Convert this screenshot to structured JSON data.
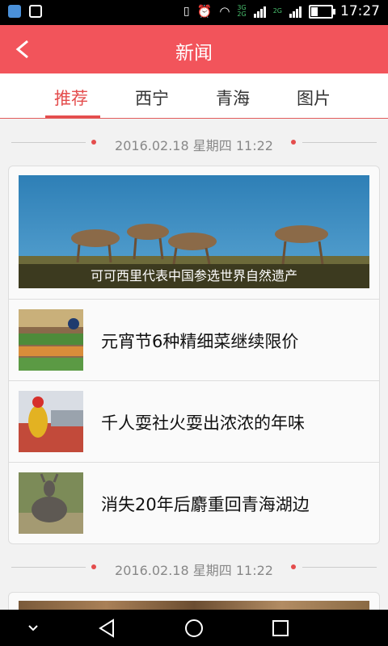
{
  "status_bar": {
    "time": "17:27",
    "net_a": "3G",
    "net_b": "2G",
    "net_c": "2G"
  },
  "header": {
    "title": "新闻",
    "back_label": "<"
  },
  "tabs": [
    {
      "label": "推荐",
      "active": true
    },
    {
      "label": "西宁",
      "active": false
    },
    {
      "label": "青海",
      "active": false
    },
    {
      "label": "图片",
      "active": false
    }
  ],
  "groups": [
    {
      "date": "2016.02.18 星期四 11:22",
      "hero_caption": "可可西里代表中国参选世界自然遗产",
      "items": [
        {
          "title": "元宵节6种精细菜继续限价"
        },
        {
          "title": "千人耍社火耍出浓浓的年味"
        },
        {
          "title": "消失20年后麝重回青海湖边"
        }
      ]
    },
    {
      "date": "2016.02.18 星期四 11:22"
    }
  ],
  "colors": {
    "accent": "#f2545b",
    "active_tab": "#e44d4d"
  }
}
